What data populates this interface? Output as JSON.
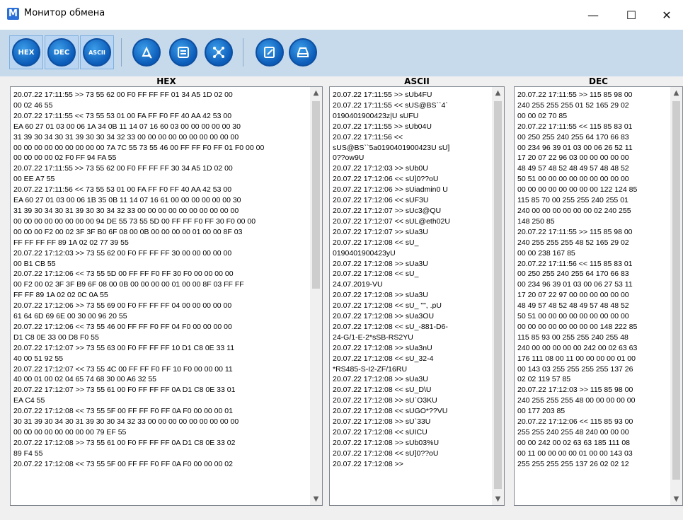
{
  "window": {
    "title": "Монитор обмена",
    "app_icon": "M",
    "minimize": "—",
    "maximize": "☐",
    "close": "✕"
  },
  "toolbar": {
    "hex_label": "HEX",
    "dec_label": "DEC",
    "ascii_label": "ASCII",
    "icons": [
      "clear-icon",
      "list-icon",
      "network-icon",
      "edit-icon",
      "display-icon"
    ]
  },
  "panels": {
    "hex": {
      "title": "HEX",
      "lines": [
        "20.07.22 17:11:55 >> 73 55 62 00 F0 FF FF FF 01 34 A5 1D 02 00",
        "00 02 46 55",
        "20.07.22 17:11:55 << 73 55 53 01 00 FA FF F0 FF 40 AA 42 53 00",
        "EA 60 27 01 03 00 06 1A 34 0B 11 14 07 16 60 03 00 00 00 00 00 30",
        "31 39 30 34 30 31 39 30 30 34 32 33 00 00 00 00 00 00 00 00 00 00",
        "00 00 00 00 00 00 00 00 00 7A 7C 55 73 55 46 00 FF FF F0 FF 01 F0 00 00",
        "00 00 00 00 02 F0 FF 94 FA 55",
        "20.07.22 17:11:55 >> 73 55 62 00 F0 FF FF FF 30 34 A5 1D 02 00",
        "00 EE A7 55",
        "20.07.22 17:11:56 << 73 55 53 01 00 FA FF F0 FF 40 AA 42 53 00",
        "EA 60 27 01 03 00 06 1B 35 0B 11 14 07 16 61 00 00 00 00 00 00 30",
        "31 39 30 34 30 31 39 30 30 34 32 33 00 00 00 00 00 00 00 00 00 00",
        "00 00 00 00 00 00 00 00 94 DE 55 73 55 5D 00 FF FF F0 FF 30 F0 00 00",
        "00 00 00 F2 00 02 3F 3F B0 6F 08 00 0B 00 00 00 00 01 00 00 8F 03",
        "FF FF FF FF 89 1A 02 02 77 39 55",
        "20.07.22 17:12:03 >> 73 55 62 00 F0 FF FF FF 30 00 00 00 00 00",
        "00 B1 CB 55",
        "20.07.22 17:12:06 << 73 55 5D 00 FF FF F0 FF 30 F0 00 00 00 00",
        "00 F2 00 02 3F 3F B9 6F 08 00 0B 00 00 00 00 01 00 00 8F 03 FF FF",
        "FF FF 89 1A 02 02 0C 0A 55",
        "20.07.22 17:12:06 >> 73 55 69 00 F0 FF FF FF 04 00 00 00 00 00",
        "61 64 6D 69 6E 00 30 00 96 20 55",
        "20.07.22 17:12:06 << 73 55 46 00 FF FF F0 FF 04 F0 00 00 00 00",
        "D1 C8 0E 33 00 D8 F0 55",
        "20.07.22 17:12:07 >> 73 55 63 00 F0 FF FF FF 10 D1 C8 0E 33 11",
        "40 00 51 92 55",
        "20.07.22 17:12:07 << 73 55 4C 00 FF FF F0 FF 10 F0 00 00 00 11",
        "40 00 01 00 02 04 65 74 68 30 00 A6 32 55",
        "20.07.22 17:12:07 >> 73 55 61 00 F0 FF FF FF 0A D1 C8 0E 33 01",
        "EA C4 55",
        "20.07.22 17:12:08 << 73 55 5F 00 FF FF F0 FF 0A F0 00 00 00 01",
        "30 31 39 30 34 30 31 39 30 30 34 32 33 00 00 00 00 00 00 00 00 00",
        "00 00 00 00 00 00 00 00 79 EF 55",
        "20.07.22 17:12:08 >> 73 55 61 00 F0 FF FF FF 0A D1 C8 0E 33 02",
        "89 F4 55",
        "20.07.22 17:12:08 << 73 55 5F 00 FF FF F0 FF 0A F0 00 00 00 02"
      ]
    },
    "ascii": {
      "title": "ASCII",
      "lines": [
        "20.07.22 17:11:55 >> sUb4FU",
        "20.07.22 17:11:55 << sUS@BS``4`",
        "0190401900423z|U sUFU",
        "20.07.22 17:11:55 >> sUb04U",
        "20.07.22 17:11:56 <<",
        "sUS@BS``5a0190401900423U sU]",
        "0??ow9U",
        "20.07.22 17:12:03 >> sUb0U",
        "20.07.22 17:12:06 << sU]0??oU",
        "20.07.22 17:12:06 >> sUiadmin0 U",
        "20.07.22 17:12:06 << sUF3U",
        "20.07.22 17:12:07 >> sUc3@QU",
        "20.07.22 17:12:07 << sUL@eth02U",
        "20.07.22 17:12:07 >> sUa3U",
        "20.07.22 17:12:08 << sU_",
        "0190401900423yU",
        "20.07.22 17:12:08 >> sUa3U",
        "20.07.22 17:12:08 << sU_",
        "24.07.2019-VU",
        "20.07.22 17:12:08 >> sUa3U",
        "20.07.22 17:12:08 << sU_ \"\", .pU",
        "20.07.22 17:12:08 >> sUa3OU",
        "20.07.22 17:12:08 << sU_-881-D6-",
        "24-G/1-E-2*sSB-RS2YU",
        "20.07.22 17:12:08 >> sUa3nU",
        "20.07.22 17:12:08 << sU_32-4",
        "*RS485-S-I2-ZF/16RU",
        "20.07.22 17:12:08 >> sUa3U",
        "20.07.22 17:12:08 << sU_D\\U",
        "20.07.22 17:12:08 >> sU`O3KU",
        "20.07.22 17:12:08 << sUGO*??VU",
        "20.07.22 17:12:08 >> sU`33U",
        "20.07.22 17:12:08 << sUICU",
        "20.07.22 17:12:08 >> sUb03%U",
        "20.07.22 17:12:08 << sU]0??oU",
        "20.07.22 17:12:08 >>"
      ]
    },
    "dec": {
      "title": "DEC",
      "lines": [
        "20.07.22 17:11:55 >> 115 85 98 00",
        "240 255 255 255 01 52 165 29 02",
        "00 00 02 70 85",
        "20.07.22 17:11:55 << 115 85 83 01",
        "00 250 255 240 255 64 170 66 83",
        "00 234 96 39 01 03 00 06 26 52 11",
        "17 20 07 22 96 03 00 00 00 00 00",
        "48 49 57 48 52 48 49 57 48 48 52",
        "50 51 00 00 00 00 00 00 00 00 00",
        "00 00 00 00 00 00 00 00 122 124 85",
        "115 85 70 00 255 255 240 255 01",
        "240 00 00 00 00 00 00 02 240 255",
        "148 250 85",
        "20.07.22 17:11:55 >> 115 85 98 00",
        "240 255 255 255 48 52 165 29 02",
        "00 00 238 167 85",
        "20.07.22 17:11:56 << 115 85 83 01",
        "00 250 255 240 255 64 170 66 83",
        "00 234 96 39 01 03 00 06 27 53 11",
        "17 20 07 22 97 00 00 00 00 00 00",
        "48 49 57 48 52 48 49 57 48 48 52",
        "50 51 00 00 00 00 00 00 00 00 00",
        "00 00 00 00 00 00 00 00 148 222 85",
        "115 85 93 00 255 255 240 255 48",
        "240 00 00 00 00 00 242 00 02 63 63",
        "176 111 08 00 11 00 00 00 00 01 00",
        "00 143 03 255 255 255 255 137 26",
        "02 02 119 57 85",
        "20.07.22 17:12:03 >> 115 85 98 00",
        "240 255 255 255 48 00 00 00 00 00",
        "00 177 203 85",
        "20.07.22 17:12:06 << 115 85 93 00",
        "255 255 240 255 48 240 00 00 00",
        "00 00 242 00 02 63 63 185 111 08",
        "00 11 00 00 00 00 01 00 00 143 03",
        "255 255 255 255 137 26 02 02 12"
      ]
    }
  }
}
